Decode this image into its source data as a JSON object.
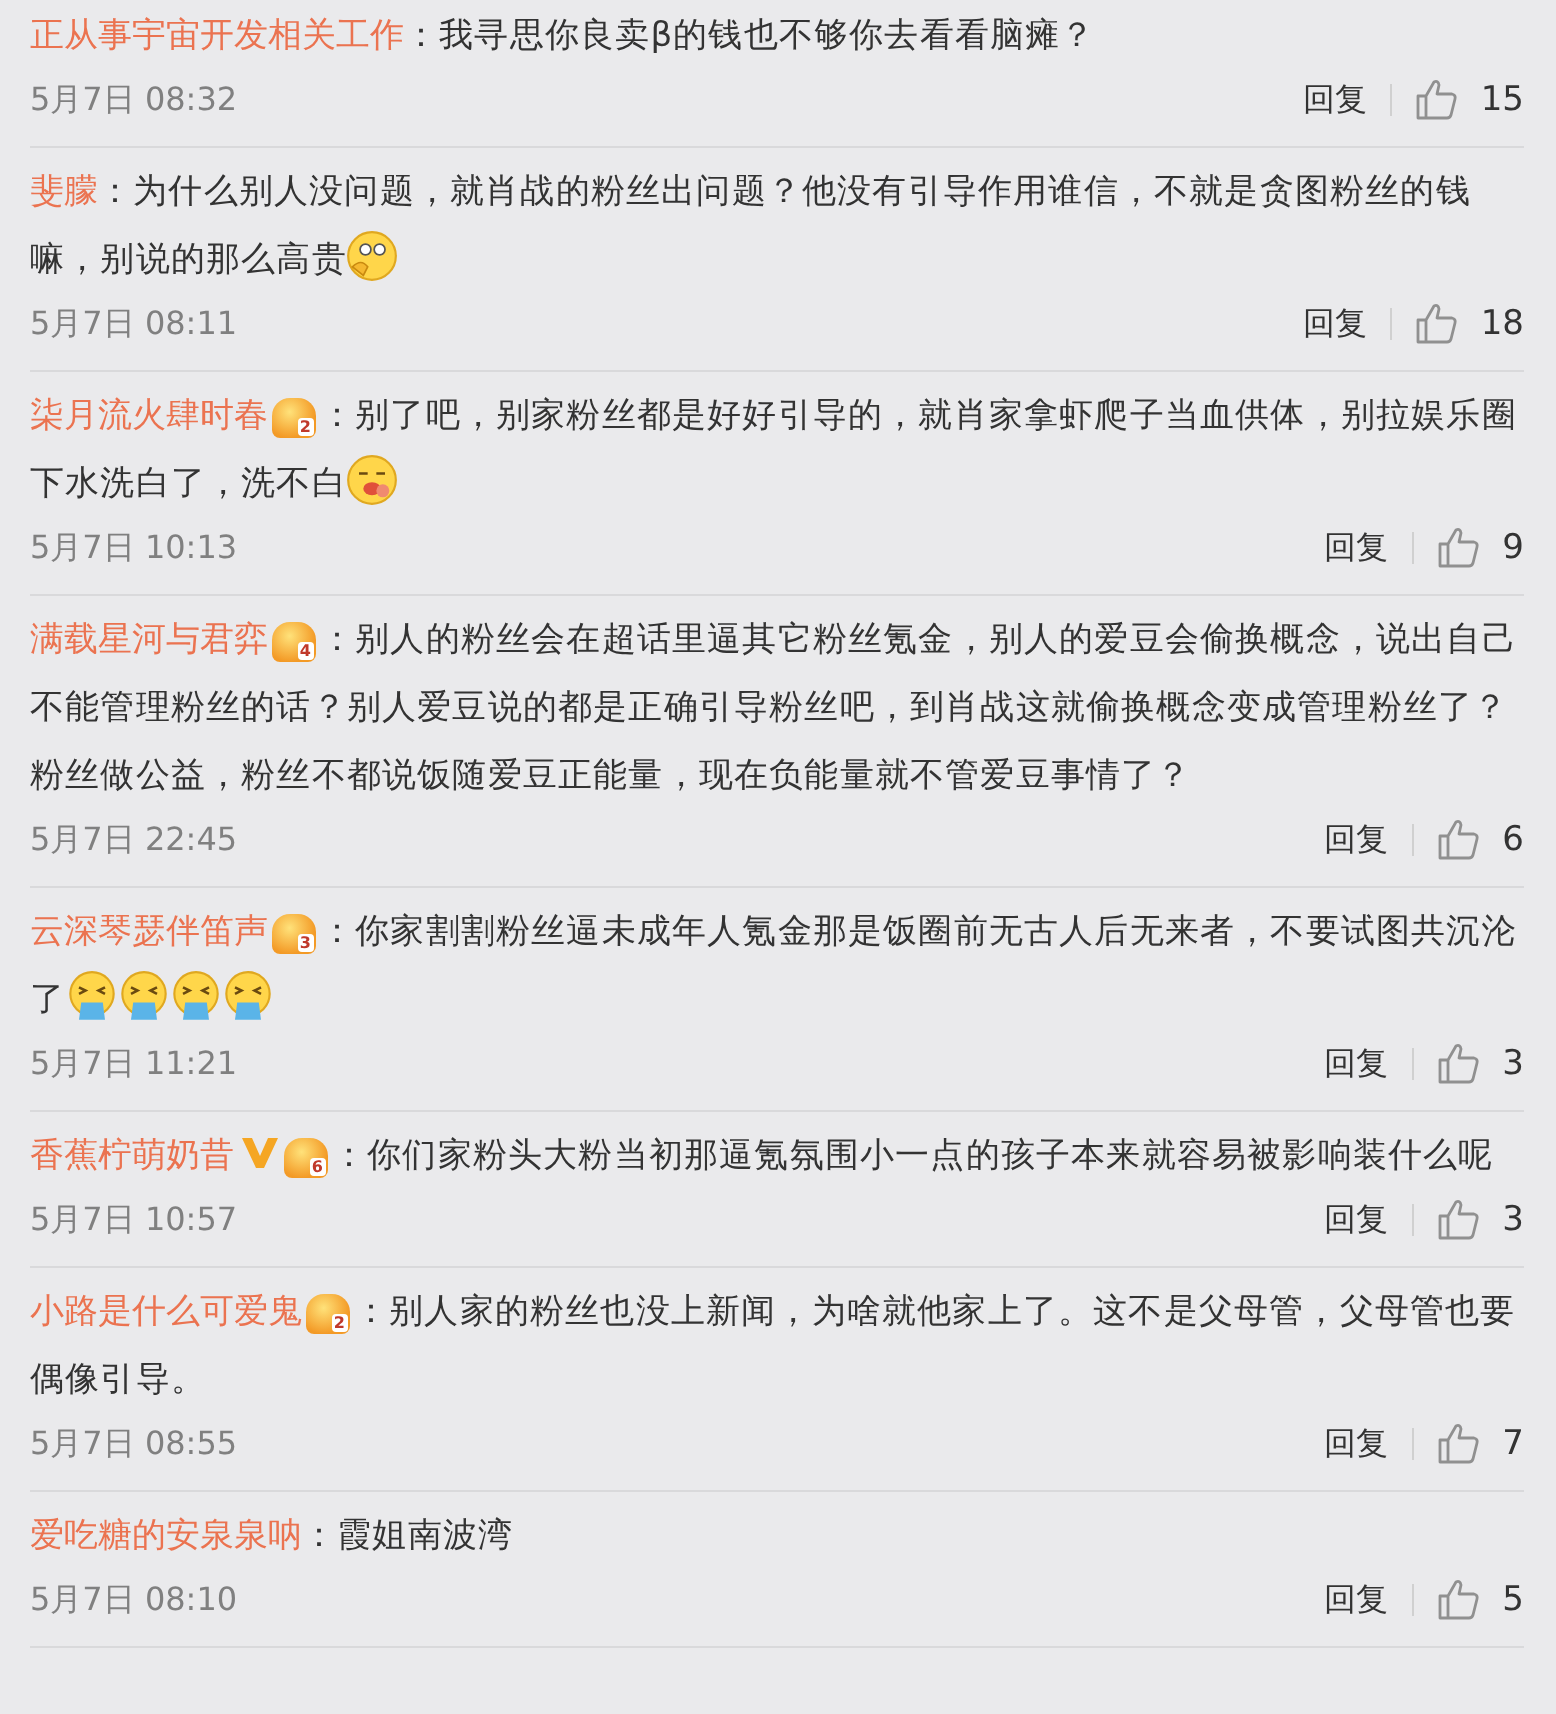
{
  "comments": [
    {
      "author": "正从事宇宙开发相关工作",
      "verified": false,
      "text": "：我寻思你良卖β的钱也不够你去看看脑瘫？",
      "date": "5月7日 08:32",
      "reply": "回复",
      "likes": "15"
    },
    {
      "author": "斐朦",
      "verified": false,
      "text": "：为什么别人没问题，就肖战的粉丝出问题？他没有引导作用谁信，不就是贪图粉丝的钱嘛，别说的那么高贵",
      "emojis": [
        {
          "kind": "thinking"
        }
      ],
      "date": "5月7日 08:11",
      "reply": "回复",
      "likes": "18"
    },
    {
      "author": "柒月流火肆时春",
      "verified": false,
      "badge": "2",
      "text": "：别了吧，别家粉丝都是好好引导的，就肖家拿虾爬子当血供体，别拉娱乐圈下水洗白了，洗不白",
      "emojis": [
        {
          "kind": "yum"
        }
      ],
      "date": "5月7日 10:13",
      "reply": "回复",
      "likes": "9"
    },
    {
      "author": "满载星河与君弈",
      "verified": false,
      "badge": "4",
      "text": "：别人的粉丝会在超话里逼其它粉丝氪金，别人的爱豆会偷换概念，说出自己不能管理粉丝的话？别人爱豆说的都是正确引导粉丝吧，到肖战这就偷换概念变成管理粉丝了？粉丝做公益，粉丝不都说饭随爱豆正能量，现在负能量就不管爱豆事情了？",
      "date": "5月7日 22:45",
      "reply": "回复",
      "likes": "6"
    },
    {
      "author": "云深琴瑟伴笛声",
      "verified": false,
      "badge": "3",
      "text": "：你家割割粉丝逼未成年人氪金那是饭圈前无古人后无来者，不要试图共沉沦了",
      "emojis": [
        {
          "kind": "vomit"
        },
        {
          "kind": "vomit"
        },
        {
          "kind": "vomit"
        },
        {
          "kind": "vomit"
        }
      ],
      "date": "5月7日 11:21",
      "reply": "回复",
      "likes": "3"
    },
    {
      "author": "香蕉柠萌奶昔",
      "verified": true,
      "badge": "6",
      "text": "：你们家粉头大粉当初那逼氪氛围小一点的孩子本来就容易被影响装什么呢",
      "date": "5月7日 10:57",
      "reply": "回复",
      "likes": "3"
    },
    {
      "author": "小路是什么可爱鬼",
      "verified": false,
      "badge": "2",
      "text": "：别人家的粉丝也没上新闻，为啥就他家上了。这不是父母管，父母管也要偶像引导。",
      "date": "5月7日 08:55",
      "reply": "回复",
      "likes": "7"
    },
    {
      "author": "爱吃糖的安泉泉呐",
      "verified": false,
      "text": "：霞姐南波湾",
      "date": "5月7日 08:10",
      "reply": "回复",
      "likes": "5"
    }
  ]
}
